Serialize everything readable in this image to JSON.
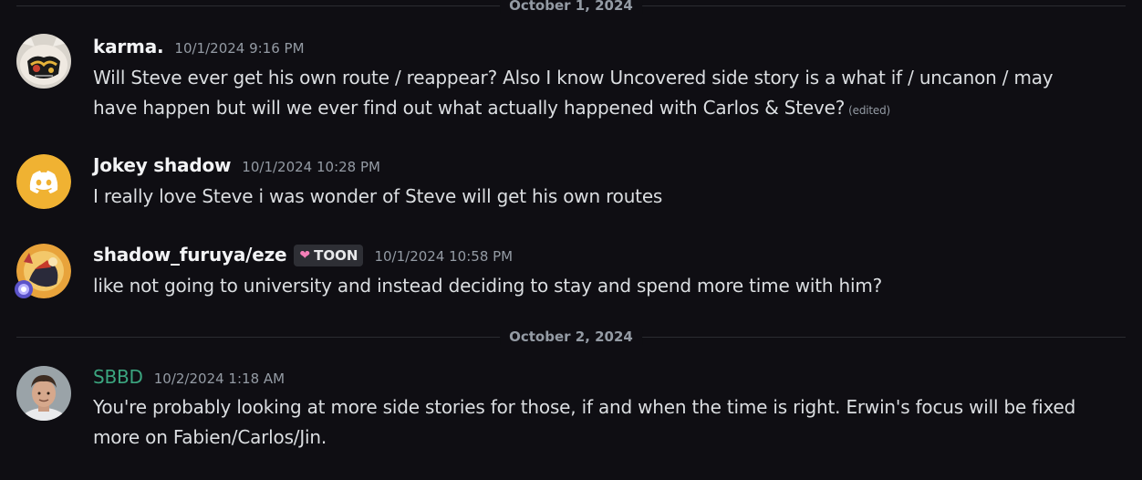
{
  "dividers": [
    {
      "label": "October 1, 2024"
    },
    {
      "label": "October 2, 2024"
    }
  ],
  "messages": [
    {
      "username": "karma.",
      "timestamp": "10/1/2024 9:16 PM",
      "line1": "Will Steve ever get his own route / reappear? Also I know Uncovered side story is a what if / uncanon / may",
      "line2": "have happen but will we ever find out what actually happened with Carlos & Steve?",
      "edited": "(edited)"
    },
    {
      "username": "Jokey shadow",
      "timestamp": "10/1/2024 10:28 PM",
      "line1": "I really love Steve i was wonder of Steve will get his own routes"
    },
    {
      "username": "shadow_furuya/eze",
      "tag": "TOON",
      "timestamp": "10/1/2024 10:58 PM",
      "line1": "like not going to university and instead deciding to stay and spend more time with him?"
    },
    {
      "username": "SBBD",
      "timestamp": "10/2/2024 1:18 AM",
      "line1": "You're probably looking at more side stories for those, if and when the time is right. Erwin's focus will be fixed",
      "line2": "more on Fabien/Carlos/Jin."
    }
  ],
  "colors": {
    "background": "#0f0e13",
    "username_sbbd": "#3ba57f",
    "discord_avatar": "#f0b232"
  }
}
